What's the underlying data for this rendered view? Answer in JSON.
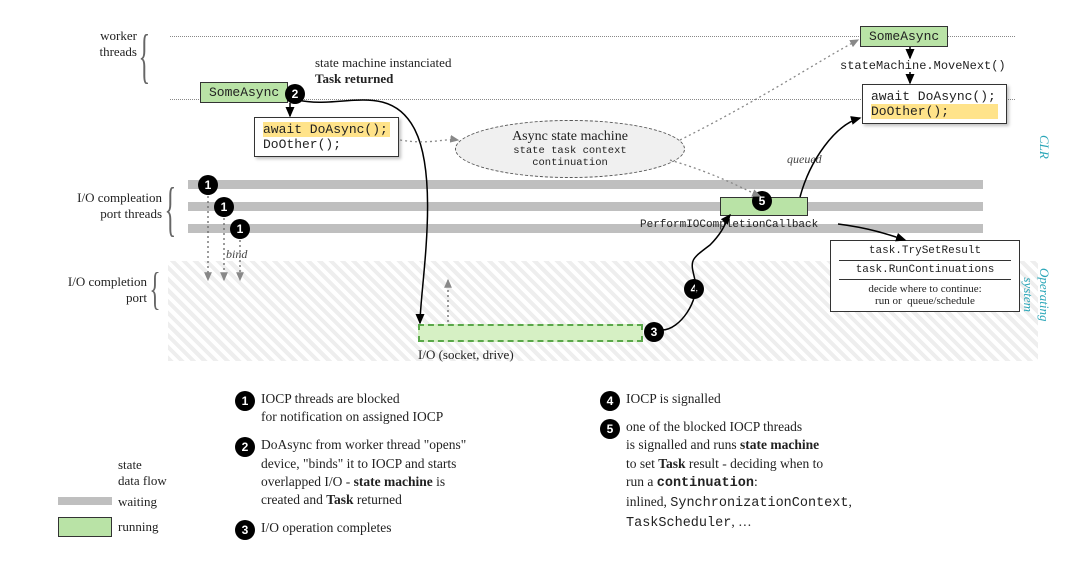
{
  "labels": {
    "worker_threads": "worker\nthreads",
    "iocp_threads": "I/O compleation\nport threads",
    "iocp_port": "I/O completion\nport",
    "state_instantiated": "state machine instanciated",
    "task_returned": "Task returned",
    "async_sm_title": "Async state machine",
    "async_sm_parts": "state   task   context   continuation",
    "queued": "queued",
    "bind": "bind",
    "io_channel": "I/O (socket, drive)",
    "movenext": "stateMachine.MoveNext()",
    "perform_cb": "PerformIOCompletionCallback",
    "cb_line1": "task.TrySetResult",
    "cb_line2": "task.RunContinuations",
    "cb_line3": "decide where to continue:\nrun or  queue/schedule",
    "side_clr": "CLR",
    "side_os": "Operating\nsystem"
  },
  "boxes": {
    "some_async": "SomeAsync",
    "await": "await DoAsync();",
    "do_other": "DoOther();"
  },
  "legend": {
    "state_df": "state\ndata flow",
    "waiting": "waiting",
    "running": "running"
  },
  "descriptions": {
    "d1": "IOCP threads are blocked\nfor notification on assigned IOCP",
    "d2_a": "DoAsync from worker thread \"opens\"\ndevice, \"binds\" it to IOCP and starts\noverlapped I/O - ",
    "d2_b": "state machine",
    "d2_c": " is\ncreated and ",
    "d2_d": "Task",
    "d2_e": " returned",
    "d3": "I/O operation completes",
    "d4": "IOCP is signalled",
    "d5_a": "one of the blocked IOCP threads\nis signalled and runs ",
    "d5_b": "state machine",
    "d5_c": "\nto set ",
    "d5_d": "Task",
    "d5_e": " result - deciding when to\nrun a ",
    "d5_f": "continuation",
    "d5_g": ":\ninlined, ",
    "d5_h": "SynchronizationContext",
    "d5_i": ",\n",
    "d5_j": "TaskScheduler",
    "d5_k": ", …"
  }
}
